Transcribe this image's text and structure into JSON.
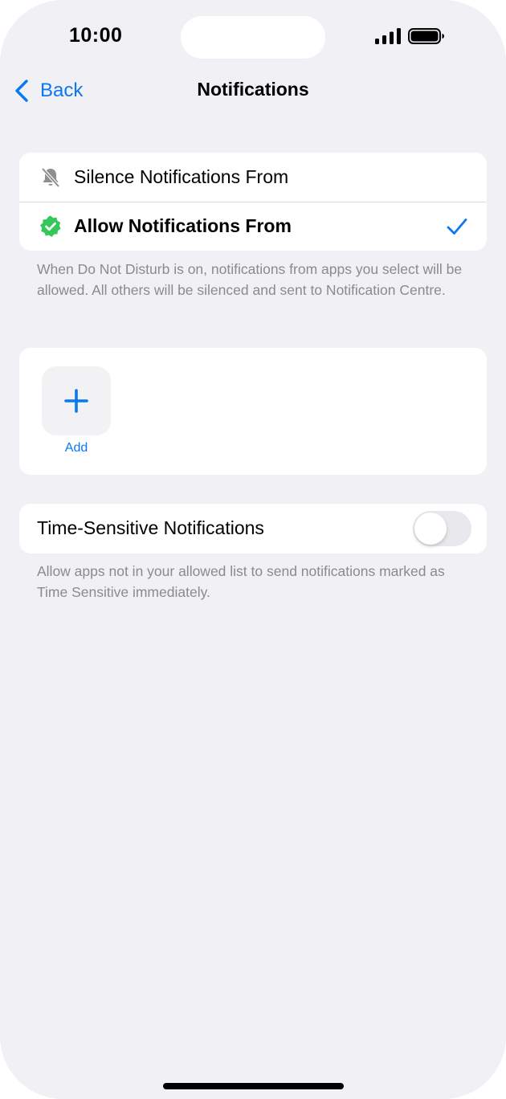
{
  "status_bar": {
    "time": "10:00",
    "signal_icon": "cellular-signal-icon",
    "battery_icon": "battery-full-icon"
  },
  "nav": {
    "back_label": "Back",
    "title": "Notifications"
  },
  "mode_options": [
    {
      "label": "Silence Notifications From",
      "icon": "bell-slash-icon",
      "selected": false
    },
    {
      "label": "Allow Notifications From",
      "icon": "green-check-badge-icon",
      "selected": true
    }
  ],
  "mode_footer": "When Do Not Disturb is on, notifications from apps you select will be allowed. All others will be silenced and sent to Notification Centre.",
  "apps": {
    "add_label": "Add"
  },
  "time_sensitive": {
    "label": "Time-Sensitive Notifications",
    "enabled": false,
    "footer": "Allow apps not in your allowed list to send notifications marked as Time Sensitive immediately."
  },
  "colors": {
    "accent": "#0a78f0",
    "badge_green": "#34c759",
    "background": "#f0f0f5",
    "secondary_text": "#8a8a8f"
  }
}
